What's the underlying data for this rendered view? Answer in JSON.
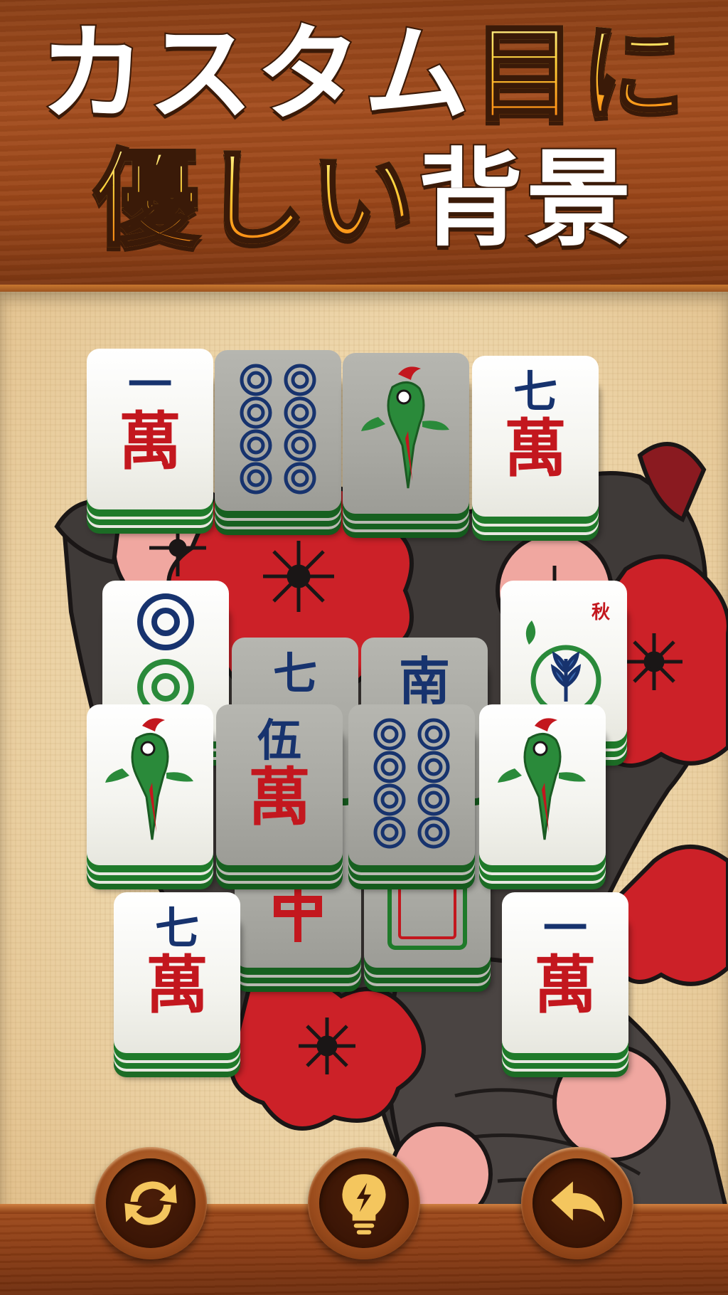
{
  "header": {
    "line1": [
      {
        "text": "カスタム",
        "style": "white"
      },
      {
        "text": "目に",
        "style": "yellow"
      }
    ],
    "line2": [
      {
        "text": "優しい",
        "style": "yellow"
      },
      {
        "text": "背景",
        "style": "white"
      }
    ]
  },
  "tiles": {
    "r1c1": {
      "top": "一",
      "bottom": "萬"
    },
    "r1c4": {
      "top": "七",
      "bottom": "萬"
    },
    "r2c4": {
      "season": "秋"
    },
    "r3c2": {
      "top": "七",
      "bottom": ""
    },
    "r3c3": {
      "top": "南",
      "bottom": ""
    },
    "r4c2": {
      "top": "伍",
      "bottom": "萬"
    },
    "r5c1": {
      "top": "七",
      "bottom": "萬"
    },
    "r5c4": {
      "top": "一",
      "bottom": "萬"
    }
  },
  "colors": {
    "tile_face": "#f4f4ef",
    "tile_side": "#1f7a2a",
    "red_char": "#c3171e",
    "blue_char": "#17336e",
    "wood": "#9a4619",
    "title_yellow": "#ffd23a"
  },
  "buttons": [
    {
      "name": "shuffle",
      "icon": "shuffle-icon"
    },
    {
      "name": "hint",
      "icon": "lightbulb-icon"
    },
    {
      "name": "undo",
      "icon": "undo-arrow-icon"
    }
  ]
}
